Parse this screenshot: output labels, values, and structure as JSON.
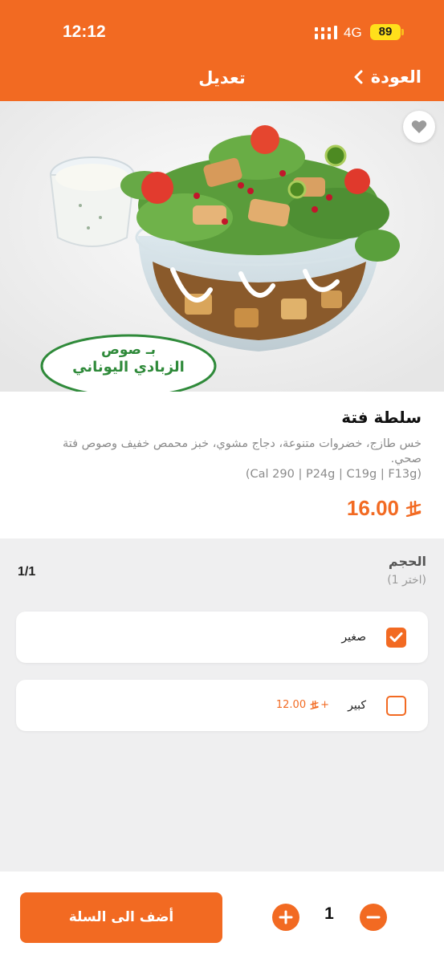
{
  "status_bar": {
    "time": "12:12",
    "network": "4G",
    "battery": "89"
  },
  "header": {
    "title": "تعديل",
    "back_label": "العودة"
  },
  "hero": {
    "sticker_line1": "بـ صوص",
    "sticker_line2": "الزبادي اليوناني",
    "favorite_icon": "heart-icon"
  },
  "product": {
    "name": "سلطة فتة",
    "description": "خس طازج، خضروات متنوعة، دجاج مشوي، خبز محمص خفيف وصوص فتة صحي.",
    "nutrition": "(Cal 290 | P24g | C19g | F13g)",
    "price": "16.00"
  },
  "options": {
    "title": "الحجم",
    "subtitle": "(اختر 1)",
    "count": "1/1",
    "items": [
      {
        "label": "صغير",
        "selected": true,
        "extra": ""
      },
      {
        "label": "كبير",
        "selected": false,
        "extra": "12.00",
        "extra_prefix": "+"
      }
    ]
  },
  "cart": {
    "add_label": "أضف الى السلة",
    "quantity": "1"
  },
  "colors": {
    "accent": "#f26a22",
    "background": "#efeff0",
    "sticker_green": "#2f8a3a"
  }
}
